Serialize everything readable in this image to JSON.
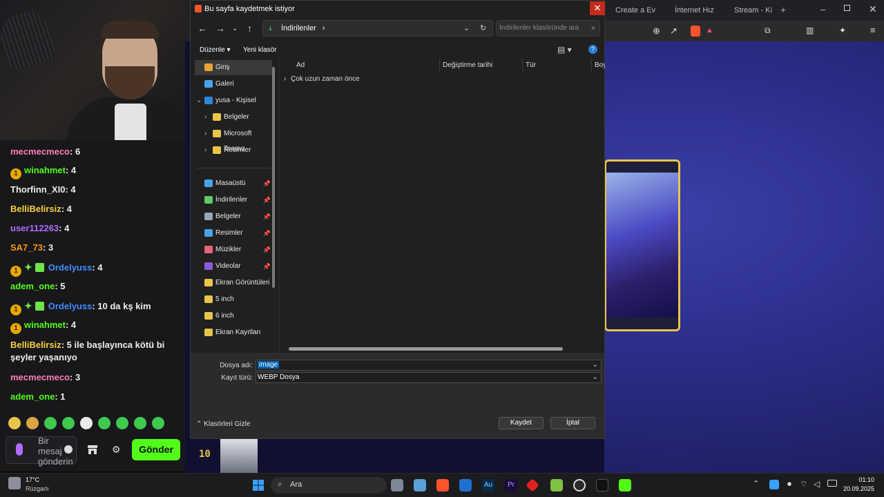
{
  "dialog": {
    "title": "Bu sayfa kaydetmek istiyor",
    "address": "İndirilenler",
    "search_placeholder": "İndirilenler klasöründe ara",
    "toolbar": {
      "organize": "Düzenle",
      "new_folder": "Yeni klasör"
    },
    "sidebar": [
      {
        "label": "Giriş",
        "icon": "home-icon",
        "pinned": false
      },
      {
        "label": "Galeri",
        "icon": "gallery-icon",
        "pinned": false
      },
      {
        "label": "yusa - Kişisel",
        "icon": "onedrive-icon",
        "pinned": false
      },
      {
        "label": "Belgeler",
        "icon": "folder-icon",
        "pinned": false
      },
      {
        "label": "Microsoft Teams",
        "icon": "folder-icon",
        "pinned": false
      },
      {
        "label": "Resimler",
        "icon": "folder-icon",
        "pinned": false
      },
      {
        "label": "Masaüstü",
        "icon": "desktop-icon",
        "pinned": true
      },
      {
        "label": "İndirilenler",
        "icon": "download-icon",
        "pinned": true
      },
      {
        "label": "Belgeler",
        "icon": "documents-icon",
        "pinned": true
      },
      {
        "label": "Resimler",
        "icon": "pictures-icon",
        "pinned": true
      },
      {
        "label": "Müzikler",
        "icon": "music-icon",
        "pinned": true
      },
      {
        "label": "Videolar",
        "icon": "videos-icon",
        "pinned": true
      },
      {
        "label": "Ekran Görüntüleri",
        "icon": "folder-icon",
        "pinned": false
      },
      {
        "label": "5 inch",
        "icon": "folder-icon",
        "pinned": false
      },
      {
        "label": "6 inch",
        "icon": "folder-icon",
        "pinned": false
      },
      {
        "label": "Ekran Kayıtları",
        "icon": "folder-icon",
        "pinned": false
      }
    ],
    "columns": [
      "Ad",
      "Değiştirme tarihi",
      "Tür",
      "Boy"
    ],
    "group": "Çok uzun zaman önce",
    "filename_label": "Dosya adı:",
    "filename_value": "image",
    "filetype_label": "Kayıt türü:",
    "filetype_value": "WEBP Dosya",
    "hide_folders": "Klasörleri Gizle",
    "save_label": "Kaydet",
    "cancel_label": "İptal"
  },
  "chat": {
    "messages": [
      {
        "user": "mecmecmeco",
        "color": "#ff7eb6",
        "text": ": 6",
        "badges": []
      },
      {
        "user": "winahmet",
        "color": "#53fc18",
        "text": ": 4",
        "badges": [
          "1"
        ]
      },
      {
        "user": "Thorfinn_XI0",
        "color": "#efeff1",
        "text": ": 4",
        "badges": []
      },
      {
        "user": "BelliBelirsiz",
        "color": "#f4d03f",
        "text": ": 4",
        "badges": []
      },
      {
        "user": "user112263",
        "color": "#b06cff",
        "text": ": 4",
        "badges": []
      },
      {
        "user": "SA7_73",
        "color": "#f39c12",
        "text": ": 3",
        "badges": []
      },
      {
        "user": "Ordelyuss",
        "color": "#3d8bfd",
        "text": ": 4",
        "badges": [
          "1",
          "spark",
          "gift"
        ]
      },
      {
        "user": "adem_one",
        "color": "#53fc18",
        "text": ": 5",
        "badges": []
      },
      {
        "user": "Ordelyuss",
        "color": "#3d8bfd",
        "text": ": 10 da kş kim",
        "badges": [
          "1",
          "spark",
          "gift"
        ]
      },
      {
        "user": "winahmet",
        "color": "#53fc18",
        "text": ": 4",
        "badges": [
          "1"
        ]
      },
      {
        "user": "BelliBelirsiz",
        "color": "#f4d03f",
        "text": ": 5 ile başlayınca kötü bi şeyler yaşanıyo",
        "badges": []
      },
      {
        "user": "mecmecmeco",
        "color": "#ff7eb6",
        "text": ": 3",
        "badges": []
      },
      {
        "user": "adem_one",
        "color": "#53fc18",
        "text": ": 1",
        "badges": []
      }
    ],
    "input_placeholder": "Bir mesaj gönderin",
    "send_label": "Gönder",
    "badge_number": "1"
  },
  "browser": {
    "tabs": [
      "Create a Ev",
      "İnternet Hız",
      "Stream - Ki"
    ],
    "page_rank": "10"
  },
  "taskbar": {
    "weather_temp": "17°C",
    "weather_desc": "Rüzgarlı",
    "search_label": "Ara",
    "time": "01:10",
    "date": "20.09.2025"
  }
}
